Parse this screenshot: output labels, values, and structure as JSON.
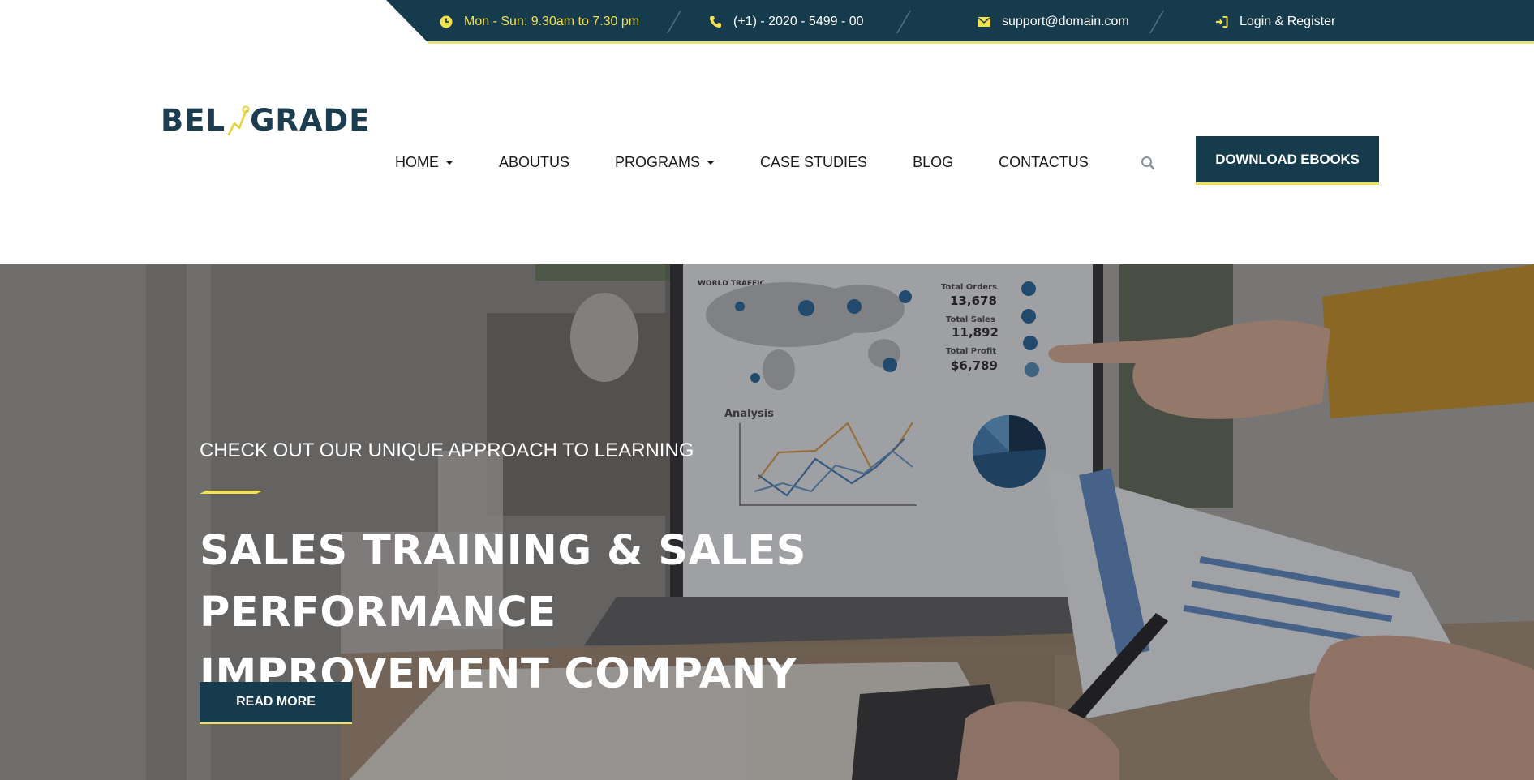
{
  "topbar": {
    "hours": "Mon - Sun: 9.30am to 7.30 pm",
    "phone": "(+1) - 2020 - 5499 - 00",
    "email": "support@domain.com",
    "login": "Login & Register",
    "icons": [
      "clock-icon",
      "phone-icon",
      "envelope-icon",
      "sign-in-icon"
    ],
    "accent_color": "#f3e24f",
    "bg_color": "#163b4c"
  },
  "logo": {
    "left": "BEL",
    "right": "GRADE"
  },
  "nav": {
    "items": [
      {
        "label": "HOME",
        "dropdown": true
      },
      {
        "label": "ABOUTUS",
        "dropdown": false
      },
      {
        "label": "PROGRAMS",
        "dropdown": true
      },
      {
        "label": "CASE STUDIES",
        "dropdown": false
      },
      {
        "label": "BLOG",
        "dropdown": false
      },
      {
        "label": "CONTACTUS",
        "dropdown": false
      }
    ],
    "download_label": "DOWNLOAD EBOOKS"
  },
  "hero": {
    "subtitle": "CHECK OUT OUR UNIQUE APPROACH TO LEARNING",
    "title_line1": "SALES TRAINING & SALES PERFORMANCE",
    "title_line2": "IMPROVEMENT COMPANY",
    "button_label": "READ MORE",
    "dashboard": {
      "heading": "WORLD TRAFFIC",
      "stats": [
        {
          "label": "Total Orders",
          "value": "13,678"
        },
        {
          "label": "Total Sales",
          "value": "11,892"
        },
        {
          "label": "Total Profit",
          "value": "$6,789"
        }
      ],
      "analysis_label": "Analysis"
    }
  }
}
